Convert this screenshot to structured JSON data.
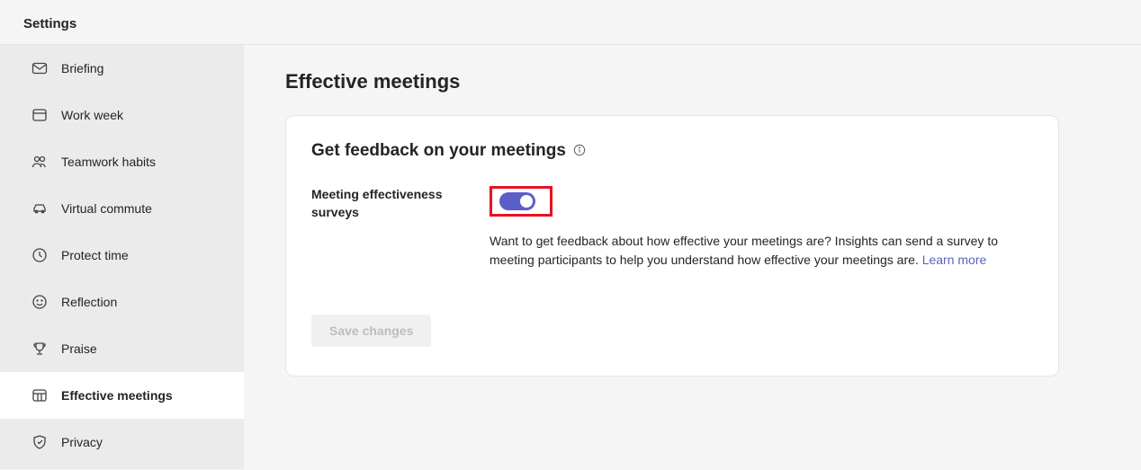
{
  "header": {
    "title": "Settings"
  },
  "sidebar": {
    "items": [
      {
        "label": "Briefing"
      },
      {
        "label": "Work week"
      },
      {
        "label": "Teamwork habits"
      },
      {
        "label": "Virtual commute"
      },
      {
        "label": "Protect time"
      },
      {
        "label": "Reflection"
      },
      {
        "label": "Praise"
      },
      {
        "label": "Effective meetings"
      },
      {
        "label": "Privacy"
      }
    ]
  },
  "main": {
    "page_title": "Effective meetings",
    "card": {
      "title": "Get feedback on your meetings",
      "setting_label": "Meeting effectiveness surveys",
      "toggle_on": true,
      "description": "Want to get feedback about how effective your meetings are? Insights can send a survey to meeting participants to help you understand how effective your meetings are. ",
      "learn_more": "Learn more",
      "save_label": "Save changes"
    }
  }
}
